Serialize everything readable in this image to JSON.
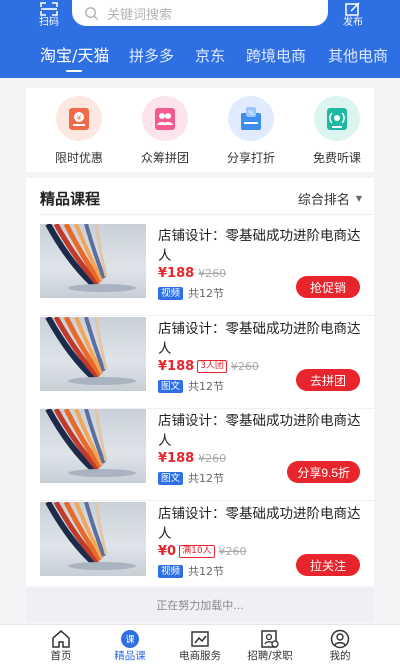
{
  "header": {
    "scan_label": "扫码",
    "search_placeholder": "关键词搜索",
    "publish_label": "发布",
    "tabs": [
      {
        "label": "淘宝/天猫",
        "active": true
      },
      {
        "label": "拼多多"
      },
      {
        "label": "京东"
      },
      {
        "label": "跨境电商"
      },
      {
        "label": "其他电商"
      }
    ]
  },
  "quick_menu": [
    {
      "label": "限时优惠",
      "icon": "coupon-icon",
      "color": "#f36a4a"
    },
    {
      "label": "众筹拼团",
      "icon": "group-icon",
      "color": "#f55a8e"
    },
    {
      "label": "分享打折",
      "icon": "share-discount-icon",
      "color": "#3d8ef0"
    },
    {
      "label": "免费听课",
      "icon": "listen-icon",
      "color": "#1fb8a2"
    }
  ],
  "courses_section": {
    "title": "精品课程",
    "sort_label": "综合排名",
    "items": [
      {
        "title": "店铺设计：零基础成功进阶电商达人",
        "price": "¥188",
        "group_tag": "",
        "old_price": "¥260",
        "type": "视频",
        "lessons": "共12节",
        "action": "抢促销"
      },
      {
        "title": "店铺设计：零基础成功进阶电商达人",
        "price": "¥188",
        "group_tag": "3人团",
        "old_price": "¥260",
        "type": "图文",
        "lessons": "共12节",
        "action": "去拼团"
      },
      {
        "title": "店铺设计：零基础成功进阶电商达人",
        "price": "¥188",
        "group_tag": "",
        "old_price": "¥260",
        "type": "图文",
        "lessons": "共12节",
        "action": "分享9.5折"
      },
      {
        "title": "店铺设计：零基础成功进阶电商达人",
        "price": "¥0",
        "group_tag": "满10人",
        "old_price": "¥260",
        "type": "视频",
        "lessons": "共12节",
        "action": "拉关注"
      }
    ]
  },
  "loading_text": "正在努力加载中...",
  "bottom_nav": [
    {
      "label": "首页",
      "icon": "home-icon"
    },
    {
      "label": "精品课",
      "icon": "course-icon",
      "active": true
    },
    {
      "label": "电商服务",
      "icon": "chart-icon"
    },
    {
      "label": "招聘/求职",
      "icon": "resume-icon"
    },
    {
      "label": "我的",
      "icon": "user-icon"
    }
  ],
  "colors": {
    "primary": "#2f6fe4",
    "accent_red": "#e8242c"
  }
}
